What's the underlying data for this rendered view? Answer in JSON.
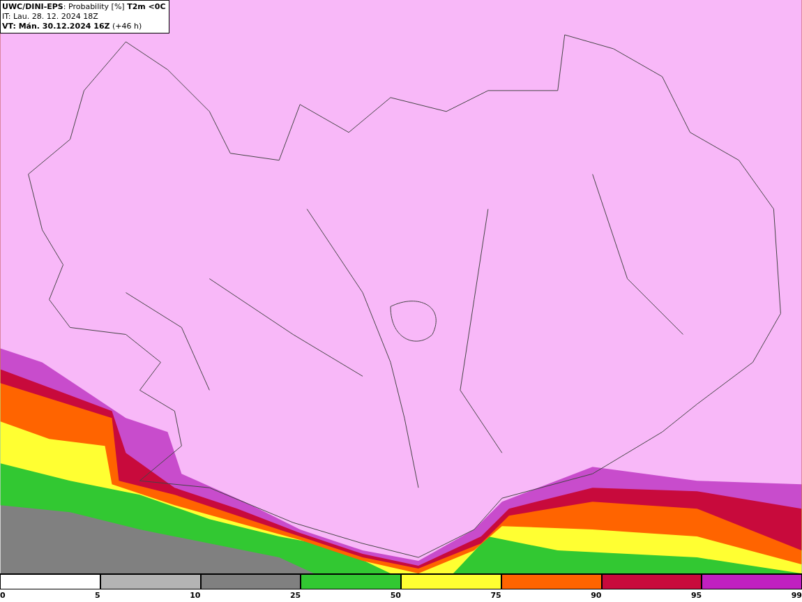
{
  "header": {
    "lines": [
      "**UWC/DINI-EPS**: Probability [%] **T2m <0C**",
      "IT: Lau. 28. 12. 2024 18Z",
      "**VT: Mán. 30.12.2024 16Z** (+46 h)"
    ]
  },
  "legend": {
    "swatches": [
      {
        "color": "#ffffff"
      },
      {
        "color": "#b4b4b4"
      },
      {
        "color": "#808080"
      },
      {
        "color": "#32c832"
      },
      {
        "color": "#ffff32"
      },
      {
        "color": "#ff6400"
      },
      {
        "color": "#c80a3c"
      },
      {
        "color": "#c020c0"
      }
    ],
    "ticks": [
      "0",
      "5",
      "10",
      "25",
      "50",
      "75",
      "90",
      "95",
      "99"
    ]
  }
}
